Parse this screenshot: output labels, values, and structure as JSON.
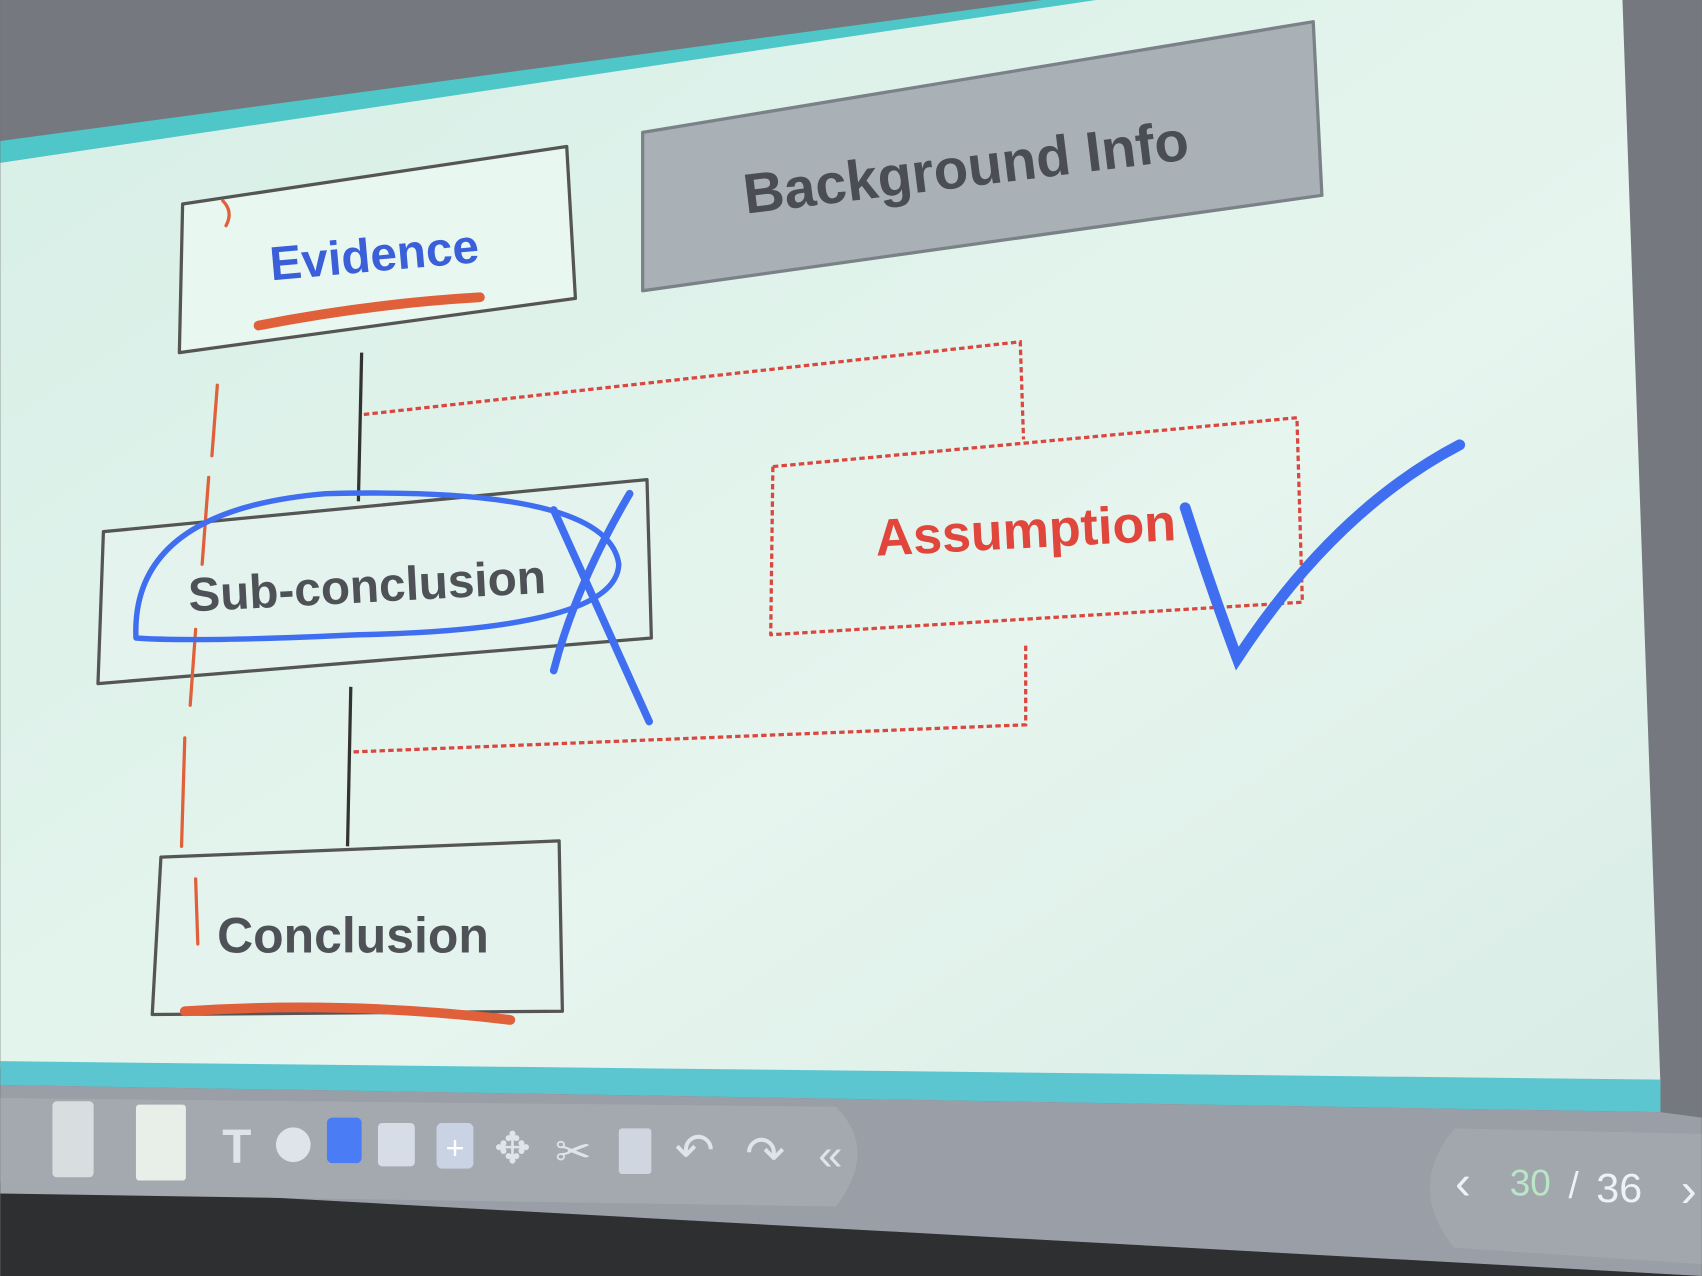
{
  "diagram": {
    "evidence": "Evidence",
    "background_info": "Background Info",
    "sub_conclusion": "Sub-conclusion",
    "assumption": "Assumption",
    "conclusion": "Conclusion"
  },
  "toolbar": {
    "tools": [
      "camera-icon",
      "eraser-icon",
      "text-icon",
      "shape-icon",
      "color-swatch-icon",
      "image-icon",
      "add-icon",
      "move-icon",
      "cut-icon",
      "trash-icon",
      "undo-icon",
      "redo-icon",
      "collapse-icon"
    ],
    "active_color": "#4a7cf5"
  },
  "pager": {
    "current": "30",
    "separator": "/",
    "total": "36"
  },
  "colors": {
    "evidence_text": "#3a5fd9",
    "assumption_text": "#e0463c",
    "annotation_blue": "#3f6ff0",
    "annotation_red": "#e0603a"
  }
}
